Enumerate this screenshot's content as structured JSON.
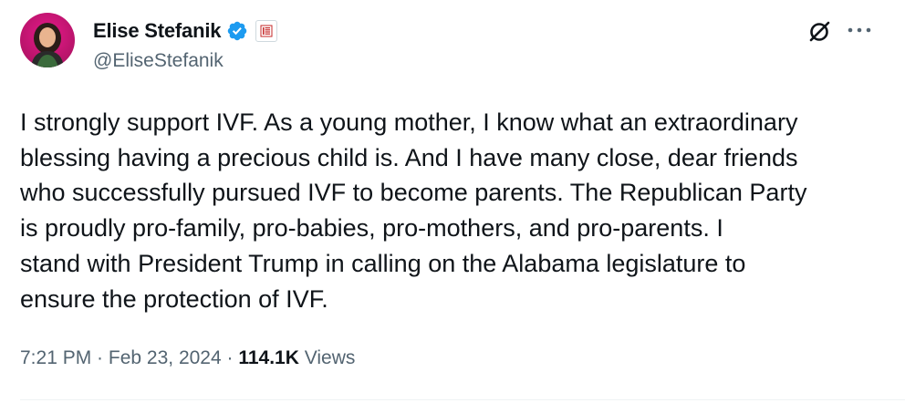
{
  "author": {
    "display_name": "Elise Stefanik",
    "handle": "@EliseStefanik",
    "verified_color": "#1d9bf0",
    "affiliate_badge": "us-house-emblem-icon"
  },
  "tweet": {
    "text": "I strongly support IVF. As a young mother, I know what an extraordinary\nblessing having a precious child is. And I have many close, dear friends\nwho successfully pursued IVF to become parents.  The Republican Party\nis proudly pro-family, pro-babies, pro-mothers, and pro-parents.  I\nstand with President Trump in calling on the Alabama legislature to\nensure the protection of IVF."
  },
  "meta": {
    "time": "7:21 PM",
    "separator": " · ",
    "date": "Feb 23, 2024",
    "views_count": "114.1K",
    "views_label": " Views"
  },
  "icons": {
    "grok": "grok-icon",
    "more": "more-options-icon"
  }
}
